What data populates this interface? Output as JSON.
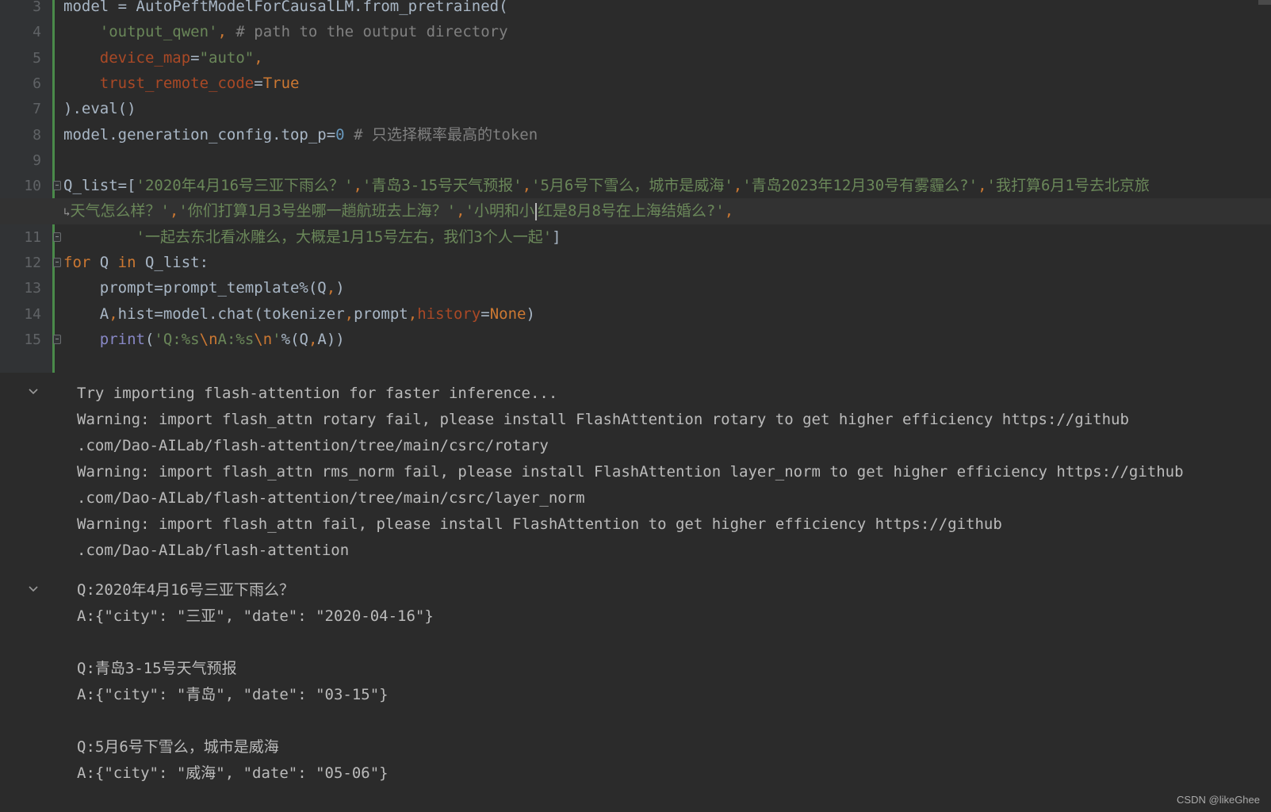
{
  "editor": {
    "lines": [
      {
        "number": "3",
        "parts": [
          {
            "t": "model = AutoPeftModelForCausalLM.from_pretrained(",
            "c": ""
          }
        ]
      },
      {
        "number": "4",
        "parts": [
          {
            "t": "    ",
            "c": ""
          },
          {
            "t": "'output_qwen'",
            "c": "str"
          },
          {
            "t": ", ",
            "c": "kw"
          },
          {
            "t": "# path to the output directory",
            "c": "cm"
          }
        ]
      },
      {
        "number": "5",
        "parts": [
          {
            "t": "    ",
            "c": ""
          },
          {
            "t": "device_map",
            "c": "param"
          },
          {
            "t": "=",
            "c": ""
          },
          {
            "t": "\"auto\"",
            "c": "str"
          },
          {
            "t": ",",
            "c": "kw"
          }
        ]
      },
      {
        "number": "6",
        "parts": [
          {
            "t": "    ",
            "c": ""
          },
          {
            "t": "trust_remote_code",
            "c": "param"
          },
          {
            "t": "=",
            "c": ""
          },
          {
            "t": "True",
            "c": "kw"
          }
        ]
      },
      {
        "number": "7",
        "parts": [
          {
            "t": ").eval()",
            "c": ""
          }
        ]
      },
      {
        "number": "8",
        "parts": [
          {
            "t": "model.generation_config.top_p=",
            "c": ""
          },
          {
            "t": "0",
            "c": "num"
          },
          {
            "t": " # 只选择概率最高的token",
            "c": "cm"
          }
        ]
      },
      {
        "number": "9",
        "parts": []
      },
      {
        "number": "10",
        "fold": true,
        "parts": [
          {
            "t": "Q_list=[",
            "c": ""
          },
          {
            "t": "'2020年4月16号三亚下雨么？'",
            "c": "str"
          },
          {
            "t": ",",
            "c": "kw"
          },
          {
            "t": "'青岛3-15号天气预报'",
            "c": "str"
          },
          {
            "t": ",",
            "c": "kw"
          },
          {
            "t": "'5月6号下雪么，城市是威海'",
            "c": "str"
          },
          {
            "t": ",",
            "c": "kw"
          },
          {
            "t": "'青岛2023年12月30号有雾霾么?'",
            "c": "str"
          },
          {
            "t": ",",
            "c": "kw"
          },
          {
            "t": "'我打算6月1号去北京旅",
            "c": "str"
          }
        ]
      },
      {
        "number": "",
        "highlight": true,
        "wrap": true,
        "parts": [
          {
            "t": "天气怎么样？'",
            "c": "str"
          },
          {
            "t": ",",
            "c": "kw"
          },
          {
            "t": "'你们打算1月3号坐哪一趟航班去上海？'",
            "c": "str"
          },
          {
            "t": ",",
            "c": "kw"
          },
          {
            "t": "'小明和小",
            "c": "str"
          },
          {
            "t": "CARET",
            "c": "caret"
          },
          {
            "t": "红是8月8号在上海结婚么?'",
            "c": "str"
          },
          {
            "t": ",",
            "c": "kw"
          }
        ]
      },
      {
        "number": "11",
        "fold": true,
        "parts": [
          {
            "t": "        ",
            "c": ""
          },
          {
            "t": "'一起去东北看冰雕么，大概是1月15号左右，我们3个人一起'",
            "c": "str"
          },
          {
            "t": "]",
            "c": ""
          }
        ]
      },
      {
        "number": "12",
        "fold": true,
        "parts": [
          {
            "t": "for",
            "c": "kw"
          },
          {
            "t": " Q ",
            "c": ""
          },
          {
            "t": "in",
            "c": "kw"
          },
          {
            "t": " Q_list:",
            "c": ""
          }
        ]
      },
      {
        "number": "13",
        "parts": [
          {
            "t": "    prompt=prompt_template%(Q",
            "c": ""
          },
          {
            "t": ",",
            "c": "kw"
          },
          {
            "t": ")",
            "c": ""
          }
        ]
      },
      {
        "number": "14",
        "parts": [
          {
            "t": "    A",
            "c": ""
          },
          {
            "t": ",",
            "c": "kw"
          },
          {
            "t": "hist=model.chat(tokenizer",
            "c": ""
          },
          {
            "t": ",",
            "c": "kw"
          },
          {
            "t": "prompt",
            "c": ""
          },
          {
            "t": ",",
            "c": "kw"
          },
          {
            "t": "history",
            "c": "param"
          },
          {
            "t": "=",
            "c": ""
          },
          {
            "t": "None",
            "c": "kw"
          },
          {
            "t": ")",
            "c": ""
          }
        ]
      },
      {
        "number": "15",
        "fold": true,
        "parts": [
          {
            "t": "    ",
            "c": ""
          },
          {
            "t": "print",
            "c": "builtin"
          },
          {
            "t": "(",
            "c": ""
          },
          {
            "t": "'Q:%s",
            "c": "str"
          },
          {
            "t": "\\n",
            "c": "esc"
          },
          {
            "t": "A:%s",
            "c": "str"
          },
          {
            "t": "\\n",
            "c": "esc"
          },
          {
            "t": "'",
            "c": "str"
          },
          {
            "t": "%(Q",
            "c": ""
          },
          {
            "t": ",",
            "c": "kw"
          },
          {
            "t": "A))",
            "c": ""
          }
        ]
      }
    ]
  },
  "output": {
    "block1": [
      "Try importing flash-attention for faster inference...",
      "Warning: import flash_attn rotary fail, please install FlashAttention rotary to get higher efficiency https://github",
      ".com/Dao-AILab/flash-attention/tree/main/csrc/rotary",
      "Warning: import flash_attn rms_norm fail, please install FlashAttention layer_norm to get higher efficiency https://github",
      ".com/Dao-AILab/flash-attention/tree/main/csrc/layer_norm",
      "Warning: import flash_attn fail, please install FlashAttention to get higher efficiency https://github",
      ".com/Dao-AILab/flash-attention"
    ],
    "block2": [
      "Q:2020年4月16号三亚下雨么？",
      "A:{\"city\": \"三亚\", \"date\": \"2020-04-16\"}",
      "",
      "Q:青岛3-15号天气预报",
      "A:{\"city\": \"青岛\", \"date\": \"03-15\"}",
      "",
      "Q:5月6号下雪么，城市是威海",
      "A:{\"city\": \"威海\", \"date\": \"05-06\"}"
    ]
  },
  "watermark": "CSDN @likeGhee",
  "icons": {
    "collapse": "chevron-down-icon",
    "fold": "fold-marker-icon",
    "wrap": "soft-wrap-icon"
  }
}
